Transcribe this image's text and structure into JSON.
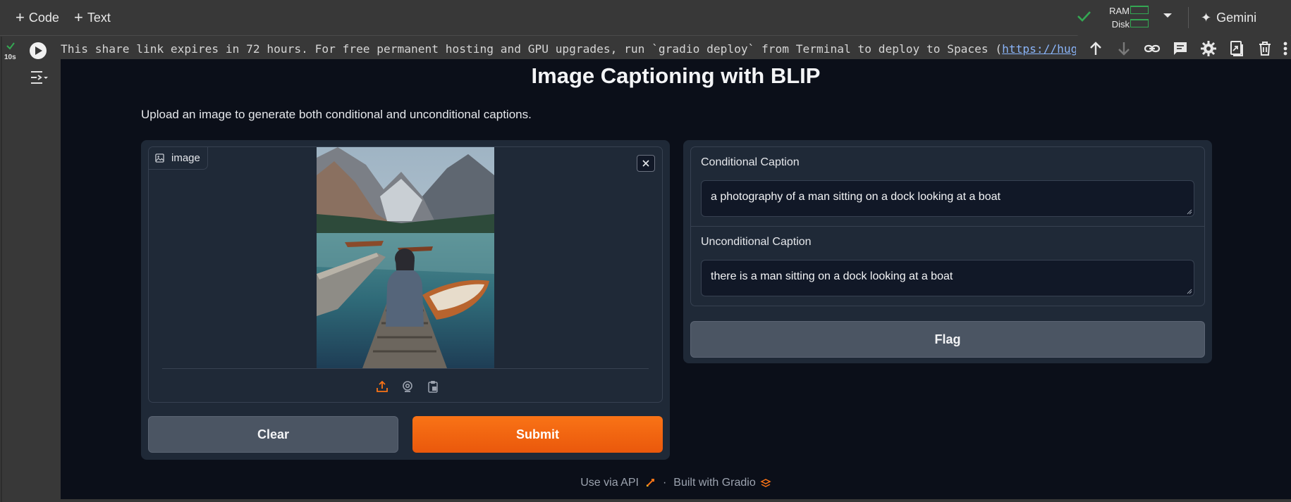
{
  "toolbar": {
    "add_code_label": "Code",
    "add_text_label": "Text",
    "ram_label": "RAM",
    "disk_label": "Disk",
    "gemini_label": "Gemini"
  },
  "cell": {
    "exec_time": "10s",
    "share_text": "This share link expires in 72 hours. For free permanent hosting and GPU upgrades, run `gradio deploy` from Terminal to deploy to Spaces (",
    "share_link": "https://huggi"
  },
  "gradio": {
    "title": "Image Captioning with BLIP",
    "description": "Upload an image to generate both conditional and unconditional captions.",
    "image_label": "image",
    "clear_label": "Clear",
    "submit_label": "Submit",
    "conditional_label": "Conditional Caption",
    "conditional_value": "a photography of a man sitting on a dock looking at a boat",
    "unconditional_label": "Unconditional Caption",
    "unconditional_value": "there is a man sitting on a dock looking at a boat",
    "flag_label": "Flag",
    "footer_api": "Use via API",
    "footer_sep": "·",
    "footer_built": "Built with Gradio"
  },
  "colors": {
    "accent_orange": "#f97316",
    "gradio_bg": "#0b0f19",
    "panel_bg": "#1f2937",
    "colab_bg": "#383838",
    "ok_green": "#34a853"
  }
}
